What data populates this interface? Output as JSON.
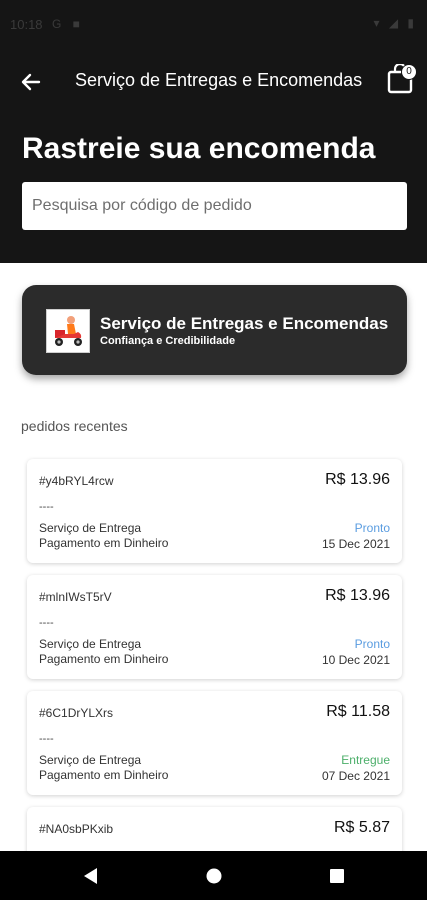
{
  "status_bar": {
    "time": "10:18",
    "left_icons": "G ■",
    "right_icons": "▾ ◢ ▮"
  },
  "app_bar": {
    "title": "Serviço de Entregas e Encomendas",
    "cart_count": "0"
  },
  "header": {
    "title": "Rastreie sua encomenda"
  },
  "search": {
    "placeholder": "Pesquisa por código de pedido"
  },
  "store_card": {
    "name": "Serviço de Entregas e Encomendas",
    "tagline": "Confiança e Credibilidade"
  },
  "recent": {
    "label": "pedidos recentes",
    "orders": [
      {
        "code": "#y4bRYL4rcw",
        "price": "R$ 13.96",
        "note": "----",
        "service": "Serviço de Entrega",
        "payment": "Pagamento em Dinheiro",
        "status": "Pronto",
        "date": "15 Dec 2021"
      },
      {
        "code": "#mlnIWsT5rV",
        "price": "R$ 13.96",
        "note": "----",
        "service": "Serviço de Entrega",
        "payment": "Pagamento em Dinheiro",
        "status": "Pronto",
        "date": "10 Dec 2021"
      },
      {
        "code": "#6C1DrYLXrs",
        "price": "R$ 11.58",
        "note": "----",
        "service": "Serviço de Entrega",
        "payment": "Pagamento em Dinheiro",
        "status": "Entregue",
        "date": "07 Dec 2021"
      },
      {
        "code": "#NA0sbPKxib",
        "price": "R$ 5.87"
      }
    ]
  },
  "colors": {
    "header_bg": "#151515",
    "card_bg": "#2b2b2b",
    "status_pronto": "#5a9ce0",
    "status_entregue": "#4caf6a"
  },
  "icons": {
    "back": "arrow-left-icon",
    "cart": "shopping-bag-icon",
    "logo": "delivery-scooter-icon",
    "nav_back": "triangle-back-icon",
    "nav_home": "circle-home-icon",
    "nav_recents": "square-recents-icon"
  }
}
